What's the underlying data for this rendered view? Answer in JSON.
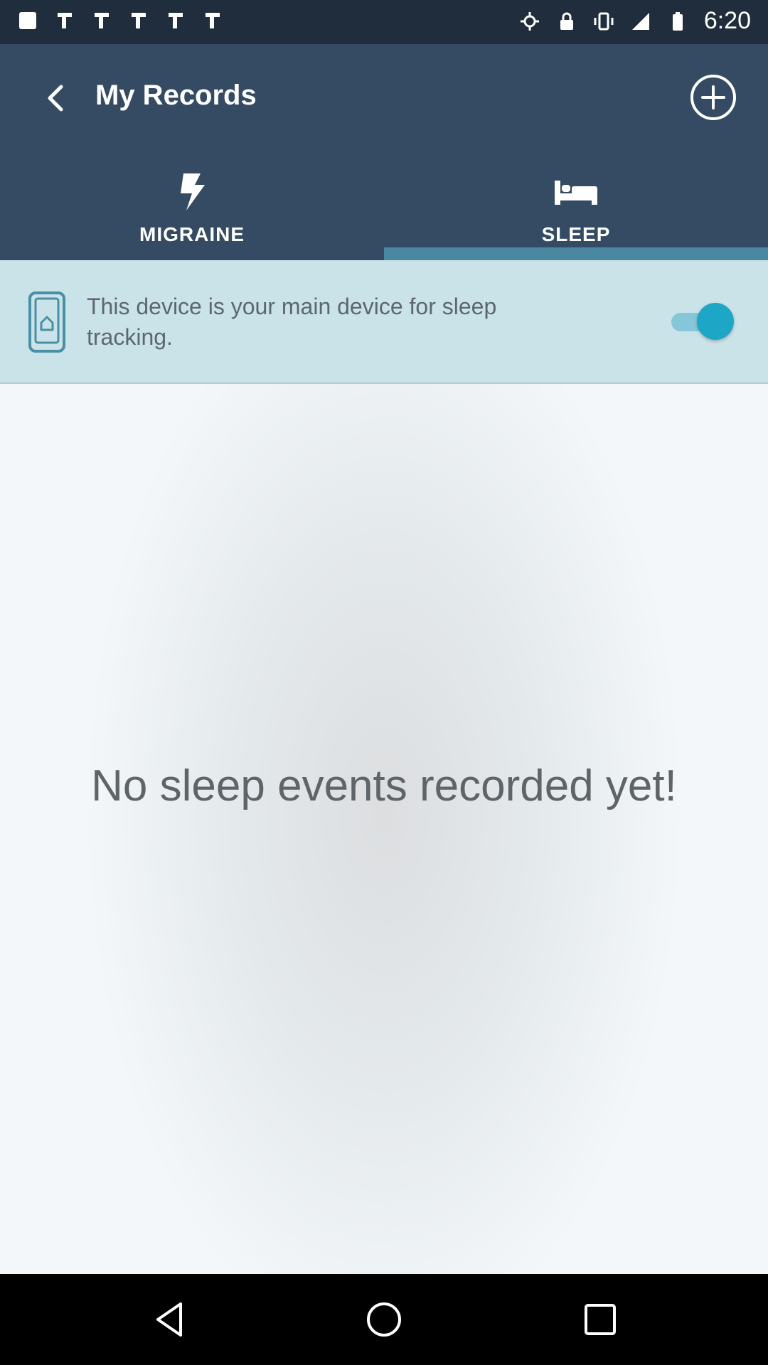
{
  "status_bar": {
    "time": "6:20",
    "icons": [
      "notification-icon",
      "notification-icon",
      "notification-icon",
      "notification-icon",
      "notification-icon",
      "notification-icon",
      "gps-icon",
      "lock-icon",
      "vibrate-icon",
      "signal-icon",
      "battery-icon"
    ]
  },
  "header": {
    "title": "My Records",
    "back_icon": "back-arrow-icon",
    "add_icon": "add-circle-icon"
  },
  "tabs": [
    {
      "label": "MIGRAINE",
      "icon": "lightning-icon",
      "selected": false
    },
    {
      "label": "SLEEP",
      "icon": "bed-icon",
      "selected": true
    }
  ],
  "device_banner": {
    "text": "This device is your main device for sleep tracking.",
    "toggle_on": true,
    "icon": "phone-home-icon"
  },
  "main": {
    "empty_message": "No sleep events recorded yet!"
  },
  "nav": {
    "back_icon": "nav-back-icon",
    "home_icon": "nav-home-icon",
    "recents_icon": "nav-recents-icon"
  },
  "colors": {
    "header": "#344b63",
    "status_bar": "#1f2d3c",
    "tab_indicator": "#4c87a2",
    "banner": "#c9e3e9",
    "toggle": "#1ea6c7"
  }
}
